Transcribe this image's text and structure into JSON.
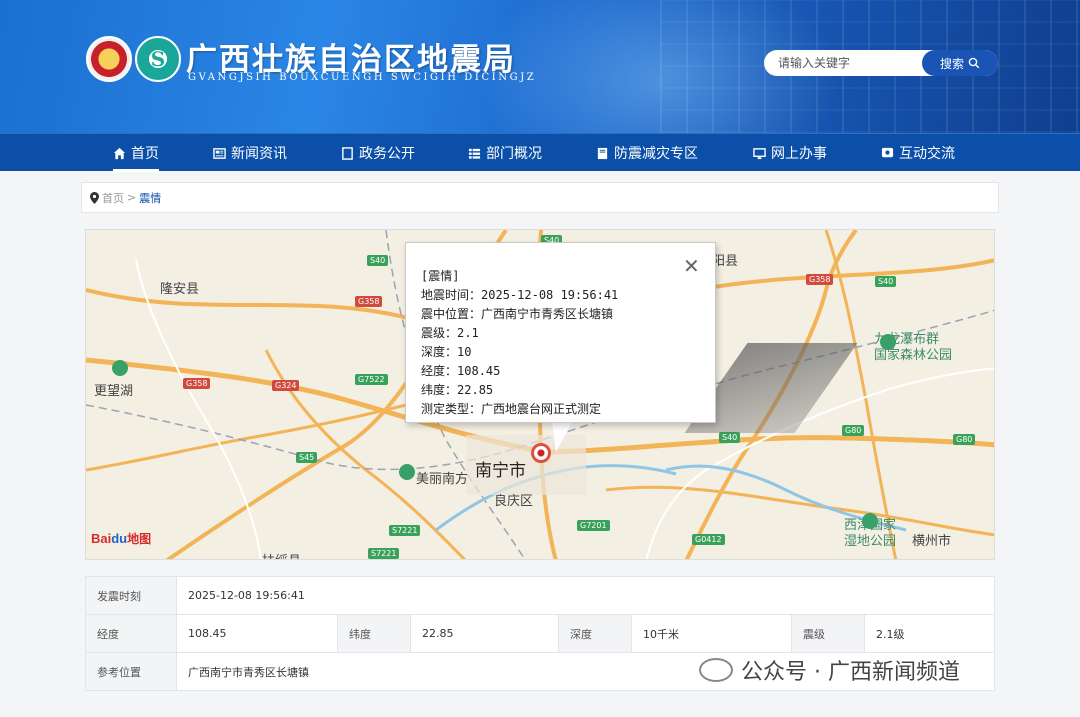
{
  "header": {
    "title": "广西壮族自治区地震局",
    "subtitle": "GVANGJSIH BOUXCUENGH SWCIGIH DICINGJZ"
  },
  "search": {
    "placeholder": "请输入关键字",
    "button_label": "搜索"
  },
  "nav": {
    "items": [
      {
        "label": "首页",
        "icon": "home-icon"
      },
      {
        "label": "新闻资讯",
        "icon": "news-icon"
      },
      {
        "label": "政务公开",
        "icon": "document-icon"
      },
      {
        "label": "部门概况",
        "icon": "list-icon"
      },
      {
        "label": "防震减灾专区",
        "icon": "book-icon"
      },
      {
        "label": "网上办事",
        "icon": "monitor-icon"
      },
      {
        "label": "互动交流",
        "icon": "chat-icon"
      }
    ],
    "active": "首页"
  },
  "breadcrumb": {
    "home": "首页",
    "separator": ">",
    "current": "震情"
  },
  "map": {
    "labels": {
      "longan": "隆安县",
      "gengwang": "更望湖",
      "nanning": "南宁市",
      "meilinanfang": "美丽南方",
      "liangqing": "良庆区",
      "jiulong": "九龙瀑布群",
      "forest": "国家森林公园",
      "xijin": "西津国家",
      "wetland": "湿地公园",
      "hengzhou": "横州市",
      "wuxu": "扶绥县",
      "bin": "阳县"
    },
    "shields": [
      "S40",
      "G358",
      "S40",
      "G358",
      "S40",
      "G358",
      "G324",
      "G7522",
      "S45",
      "S40",
      "G80",
      "G80",
      "S7221",
      "G7201",
      "S7221",
      "G0412"
    ],
    "logo": {
      "bai": "Bai",
      "du": "du",
      "map": "地图"
    },
    "popup": {
      "heading": "[震情]",
      "time_label": "地震时间：",
      "time": "2025-12-08 19:56:41",
      "location_label": "震中位置：",
      "location": "广西南宁市青秀区长塘镇",
      "magnitude_label": "震级：",
      "magnitude": "2.1",
      "depth_label": "深度：",
      "depth": "10",
      "longitude_label": "经度：",
      "longitude": "108.45",
      "latitude_label": "纬度：",
      "latitude": "22.85",
      "type_partial": "测定类型：广西地震台网正式测定"
    }
  },
  "table": {
    "time_label": "发震时刻",
    "time": "2025-12-08 19:56:41",
    "longitude_label": "经度",
    "longitude": "108.45",
    "latitude_label": "纬度",
    "latitude": "22.85",
    "depth_label": "深度",
    "depth": "10千米",
    "magnitude_label": "震级",
    "magnitude": "2.1级",
    "location_label": "参考位置",
    "location": "广西南宁市青秀区长塘镇"
  },
  "watermark": "公众号 · 广西新闻频道"
}
